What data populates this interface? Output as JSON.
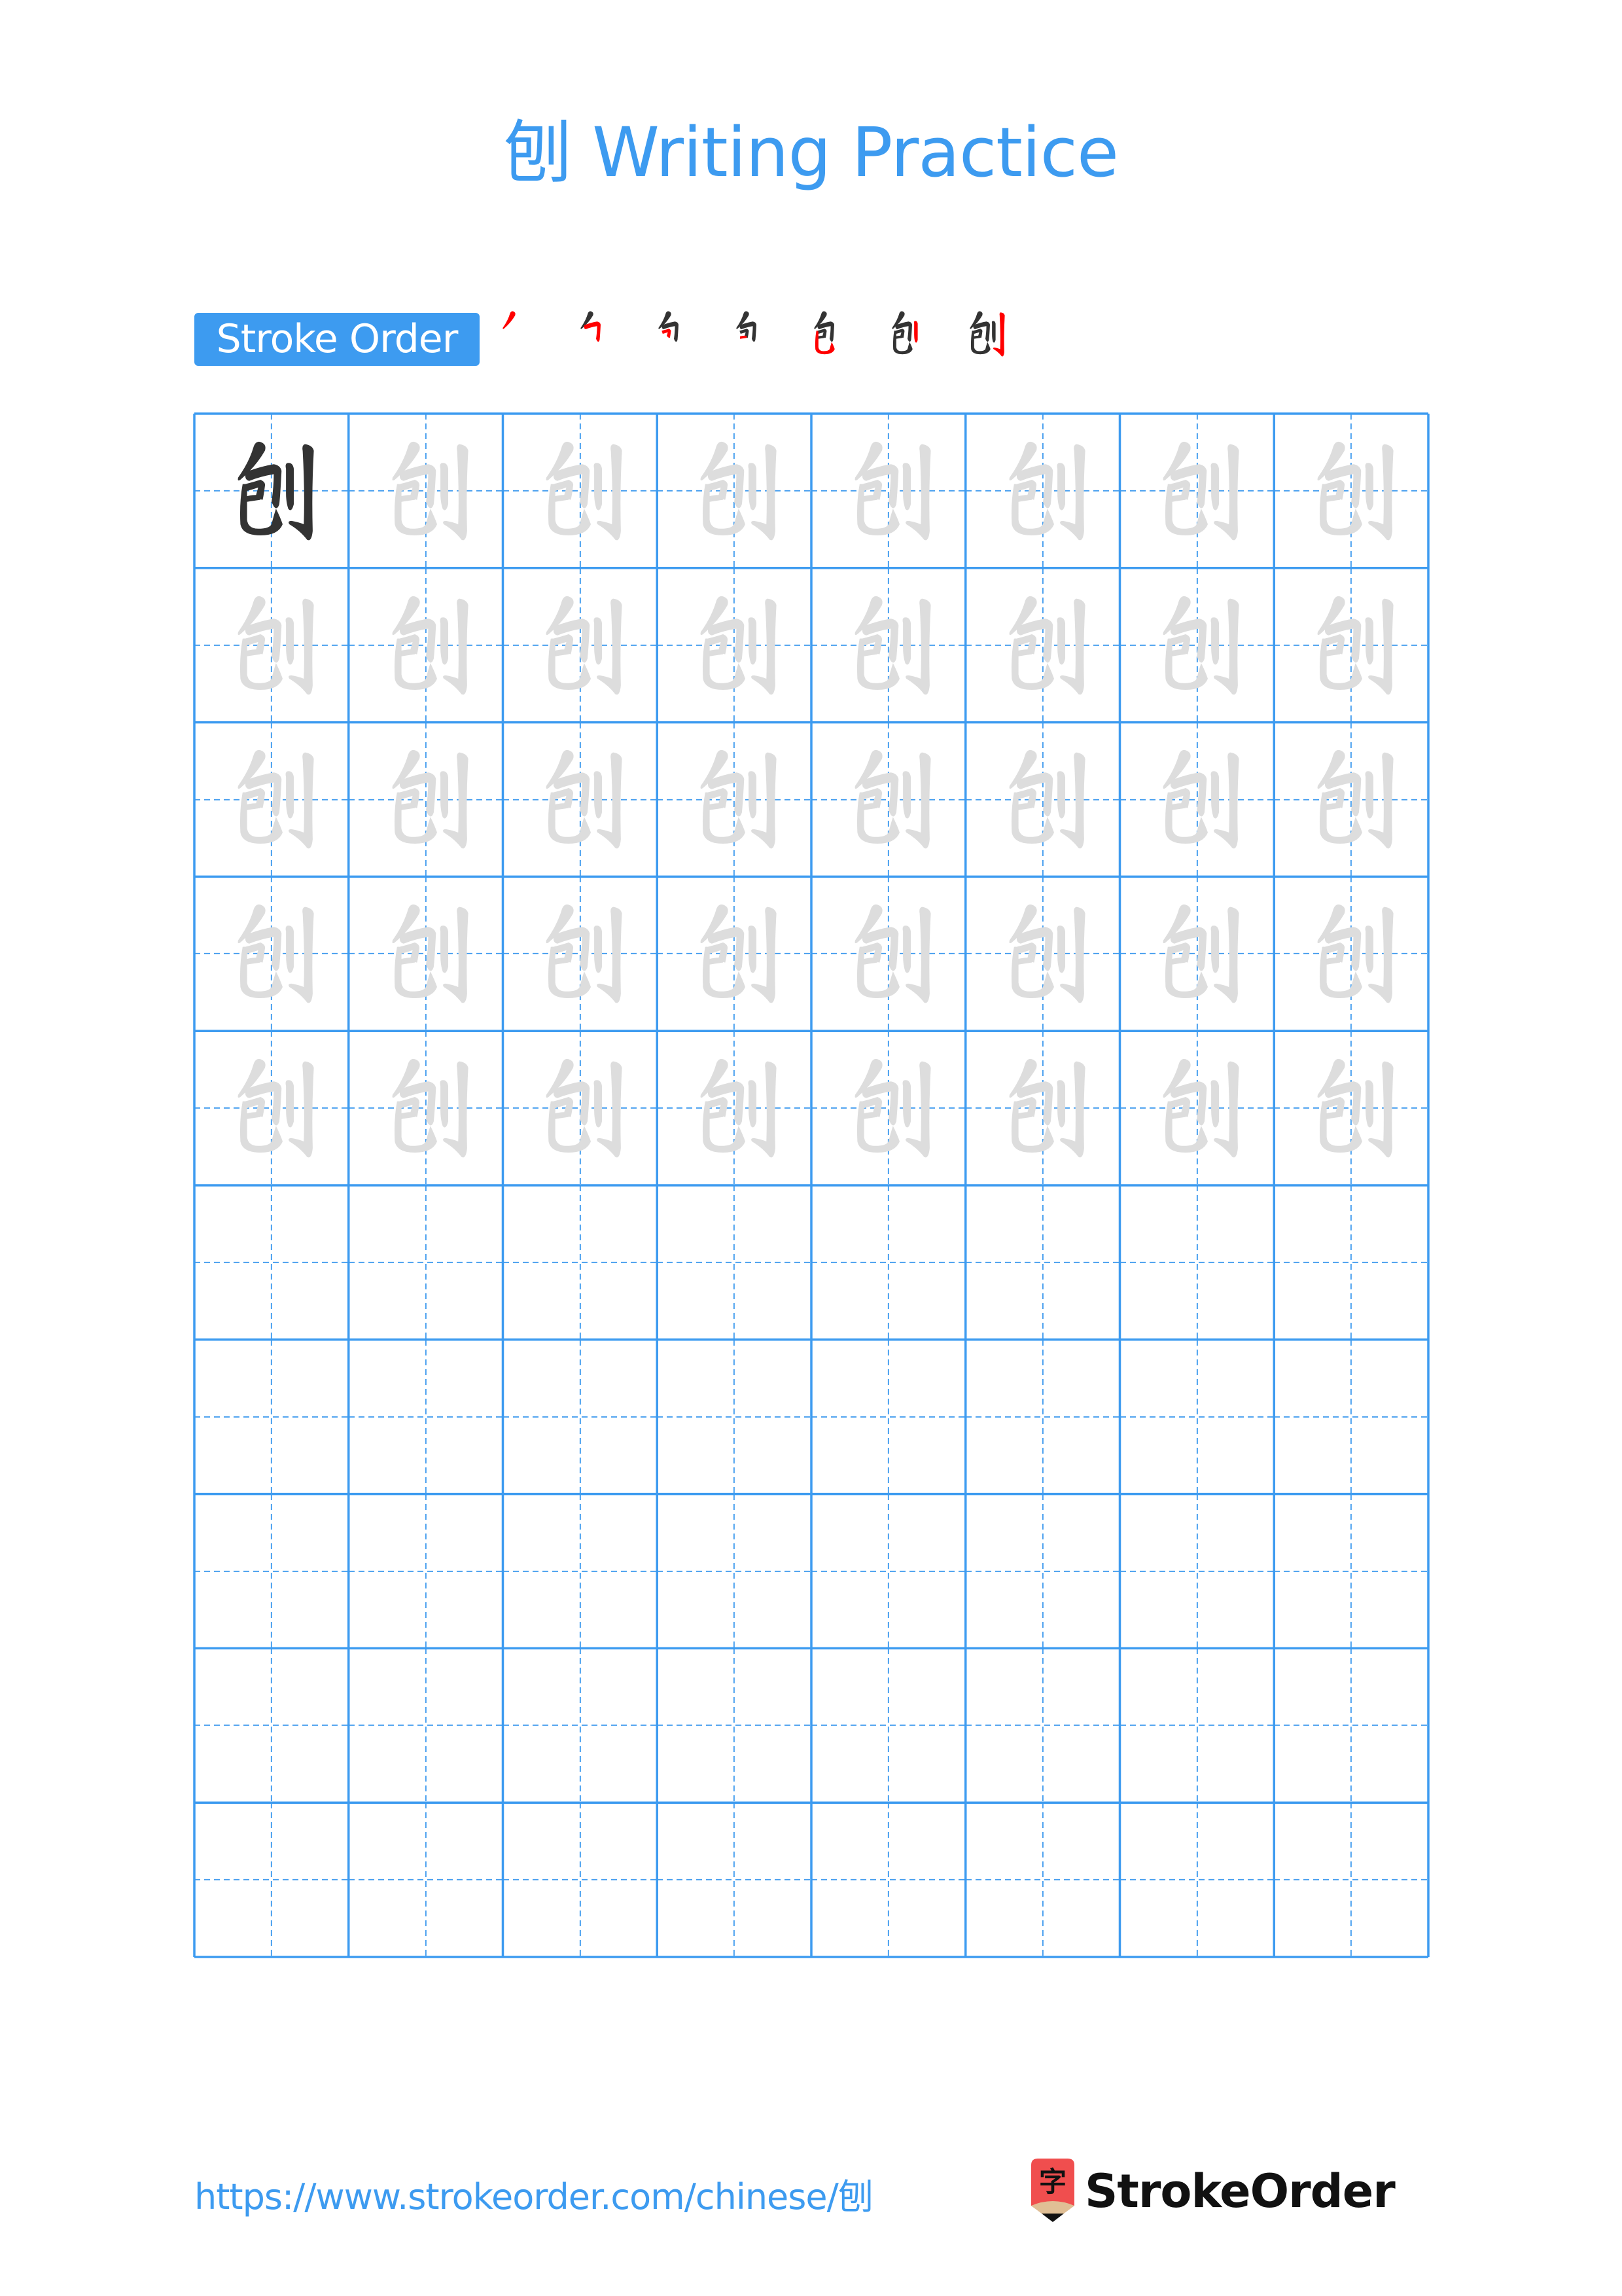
{
  "page": {
    "character": "刨",
    "title": "刨 Writing Practice"
  },
  "stroke_order": {
    "label": "Stroke Order",
    "step_count": 7,
    "steps": [
      {
        "index": 1,
        "description": "piě (left-falling) — first stroke of 勹"
      },
      {
        "index": 2,
        "description": "héng zhé gōu — 勹 enclosure"
      },
      {
        "index": 3,
        "description": "héng zhé inside"
      },
      {
        "index": 4,
        "description": "héng inside"
      },
      {
        "index": 5,
        "description": "shù wān gōu — completes 包"
      },
      {
        "index": 6,
        "description": "shù — short vertical of 刂"
      },
      {
        "index": 7,
        "description": "shù gōu — long hooked vertical of 刂"
      }
    ],
    "highlight_color": "#ff0000",
    "done_color": "#333333"
  },
  "practice_grid": {
    "columns": 8,
    "rows": 10,
    "model_cells": 1,
    "trace_rows": 5,
    "blank_rows": 5,
    "model_color": "#333333",
    "trace_color": "#dddddd",
    "line_color": "#3d9bf0",
    "guide_color": "#4aa0ef"
  },
  "footer": {
    "url": "https://www.strokeorder.com/chinese/刨",
    "brand": "StrokeOrder",
    "logo_glyph": "字"
  },
  "colors": {
    "accent": "#3d9bf0",
    "logo_red": "#f04e4e",
    "logo_tan": "#e0bf95"
  }
}
